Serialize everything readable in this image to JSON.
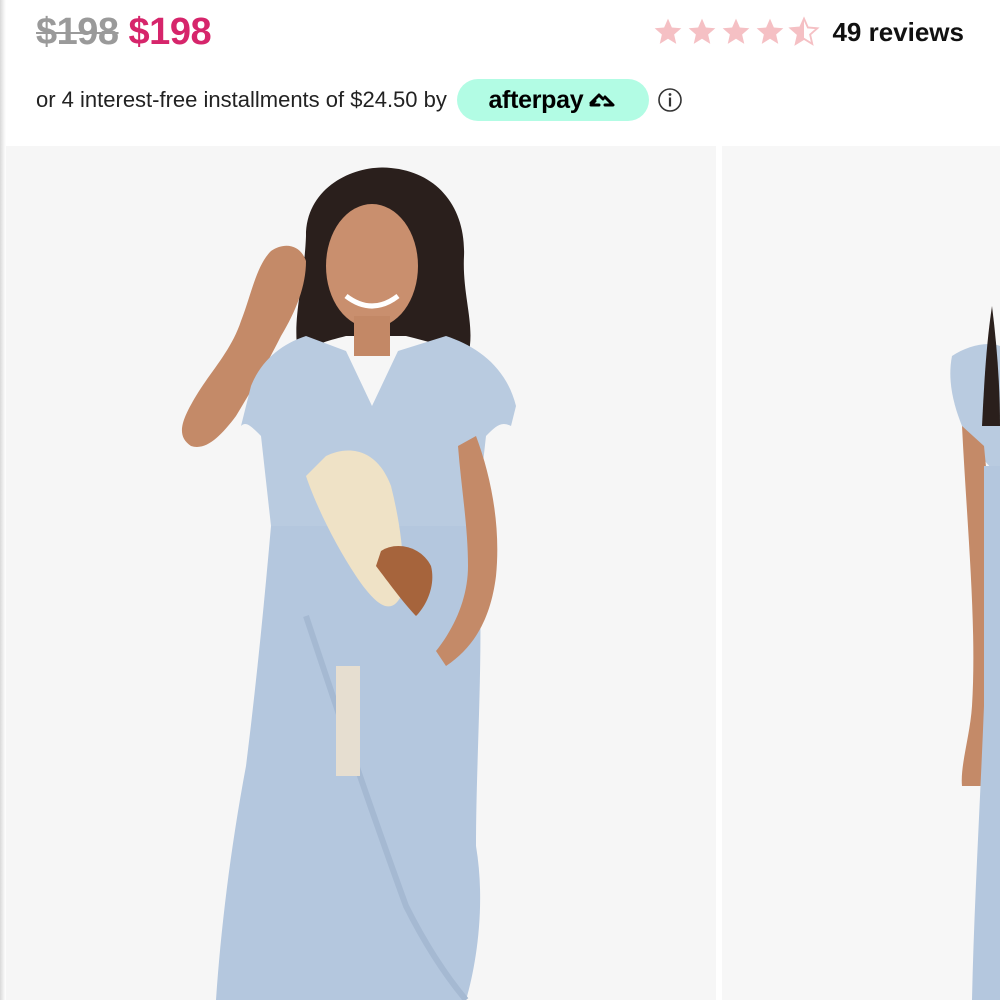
{
  "pricing": {
    "original_price": "$198",
    "sale_price": "$198"
  },
  "rating": {
    "value": 4.5,
    "max": 5,
    "star_color": "#f5c0c4",
    "reviews_label": "49 reviews"
  },
  "installments": {
    "text": "or 4 interest-free installments of $24.50 by",
    "provider_name": "afterpay",
    "provider_badge_color": "#b2fce4",
    "info_icon": "info-circle-icon"
  },
  "gallery": {
    "images": [
      {
        "name": "model-front-view-photo"
      },
      {
        "name": "model-side-view-photo"
      }
    ]
  },
  "colors": {
    "sale_price": "#d6256b",
    "original_price": "#9a9a9a",
    "dress": "#b9cbe0"
  }
}
